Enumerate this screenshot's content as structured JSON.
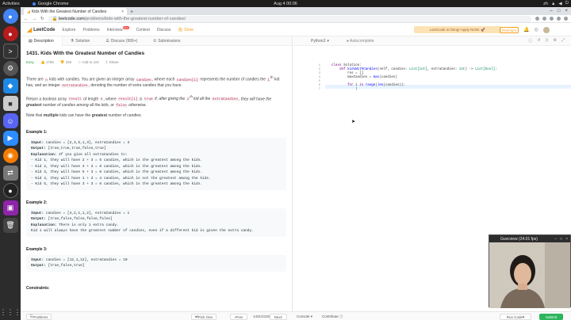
{
  "topbar": {
    "activities": "Activities",
    "app": "Google Chrome",
    "clock": "Aug 4  00:06",
    "lang": "zh"
  },
  "chrome": {
    "tab_title": "Kids With the Greatest Number of Candies",
    "url_host": "leetcode.com",
    "url_path": "/problems/kids-with-the-greatest-number-of-candies/"
  },
  "nav": {
    "logo": "LeetCode",
    "items": [
      "Explore",
      "Problems",
      "Interview",
      "Contest",
      "Discuss",
      "Store"
    ],
    "new_badge": "New",
    "banner": "LeetCode is hiring! Apply NOW. 🚀",
    "premium": "Premium"
  },
  "left_tabs": {
    "description": "Description",
    "solution": "Solution",
    "discuss": "Discuss (999+)",
    "submissions": "Submissions"
  },
  "problem": {
    "title": "1431. Kids With the Greatest Number of Candies",
    "difficulty": "Easy",
    "likes": "1796",
    "dislikes": "292",
    "add_to_list": "Add to List",
    "share": "Share",
    "p1_a": "There are ",
    "p1_n": "n",
    "p1_b": " kids with candies. You are given an integer array ",
    "p1_candies": "candies",
    "p1_c": ", where each ",
    "p1_ci": "candies[i]",
    "p1_d": " represents the number of candies the ",
    "p1_ith": "i",
    "p1_sup": "th",
    "p1_e": " kid has, and an integer ",
    "p1_extra": "extraCandies",
    "p1_f": ", denoting the number of extra candies that you have.",
    "p2_a": "Return a boolean array ",
    "p2_result": "result",
    "p2_b": " of length ",
    "p2_n": "n",
    "p2_c": ", where ",
    "p2_ri": "result[i]",
    "p2_d": " is ",
    "p2_true": "true",
    "p2_e": " if, after giving the ",
    "p2_ith": "i",
    "p2_sup": "th",
    "p2_f": " kid all the ",
    "p2_extra": "extraCandies",
    "p2_g": ", they will have the ",
    "p2_greatest": "greatest",
    "p2_h": " number of candies among all the kids, or ",
    "p2_false": "false",
    "p2_i": " otherwise.",
    "p3_a": "Note that ",
    "p3_multiple": "multiple",
    "p3_b": " kids can have the ",
    "p3_greatest": "greatest",
    "p3_c": " number of candies.",
    "examples": [
      {
        "title": "Example 1:",
        "lines": [
          {
            "label": "Input:",
            "text": " candies = [2,3,5,1,3], extraCandies = 3"
          },
          {
            "label": "Output:",
            "text": " [true,true,true,false,true]"
          },
          {
            "label": "Explanation:",
            "text": " If you give all extraCandies to:"
          },
          {
            "label": "",
            "text": "- Kid 1, they will have 2 + 3 = 5 candies, which is the greatest among the kids."
          },
          {
            "label": "",
            "text": "- Kid 2, they will have 3 + 3 = 6 candies, which is the greatest among the kids."
          },
          {
            "label": "",
            "text": "- Kid 3, they will have 5 + 3 = 8 candies, which is the greatest among the kids."
          },
          {
            "label": "",
            "text": "- Kid 4, they will have 1 + 3 = 4 candies, which is not the greatest among the kids."
          },
          {
            "label": "",
            "text": "- Kid 5, they will have 3 + 3 = 6 candies, which is the greatest among the kids."
          }
        ]
      },
      {
        "title": "Example 2:",
        "lines": [
          {
            "label": "Input:",
            "text": " candies = [4,2,1,1,2], extraCandies = 1"
          },
          {
            "label": "Output:",
            "text": " [true,false,false,false,false]"
          },
          {
            "label": "Explanation:",
            "text": " There is only 1 extra candy."
          },
          {
            "label": "",
            "text": "Kid 1 will always have the greatest number of candies, even if a different kid is given the extra candy."
          }
        ]
      },
      {
        "title": "Example 3:",
        "lines": [
          {
            "label": "Input:",
            "text": " candies = [12,1,12], extraCandies = 10"
          },
          {
            "label": "Output:",
            "text": " [true,false,true]"
          }
        ]
      }
    ],
    "constraints": "Constraints:"
  },
  "editor": {
    "language": "Python3",
    "autocomplete": "Autocomplete",
    "line_numbers": [
      "1",
      "2",
      "3",
      "4",
      "5",
      "6",
      "7"
    ],
    "code": {
      "l1_kw": "class",
      "l1_name": " Solution:",
      "l2_kw": "def",
      "l2_fn": " kidsWithCandies",
      "l2_rest": "(self, candies: ",
      "l2_t1": "List[int]",
      "l2_rest2": ", extraCandies: ",
      "l2_t2": "int",
      "l2_rest3": ") -> ",
      "l2_t3": "List[bool]",
      "l2_end": ":",
      "l3": "        res = []",
      "l4_a": "        maxCandies = ",
      "l4_fn": "max",
      "l4_b": "(candies)",
      "l5": "",
      "l6_kw": "        for",
      "l6_a": " i ",
      "l6_kw2": "in",
      "l6_fn": " range",
      "l6_b": "(",
      "l6_fn2": "len",
      "l6_c": "(candies)):",
      "l7": "            "
    }
  },
  "bottom": {
    "problems": "Problems",
    "pick_one": "Pick One",
    "prev": "Prev",
    "page": "1431/2119",
    "next": "Next",
    "console": "Console",
    "contribute": "Contribute",
    "run_code": "Run Code",
    "submit": "Submit"
  },
  "cam": {
    "title": "Guvcview (24.01 fps)"
  },
  "colors": {
    "accent": "#f89f1b",
    "easy": "#43a047",
    "submit": "#2db55d"
  }
}
